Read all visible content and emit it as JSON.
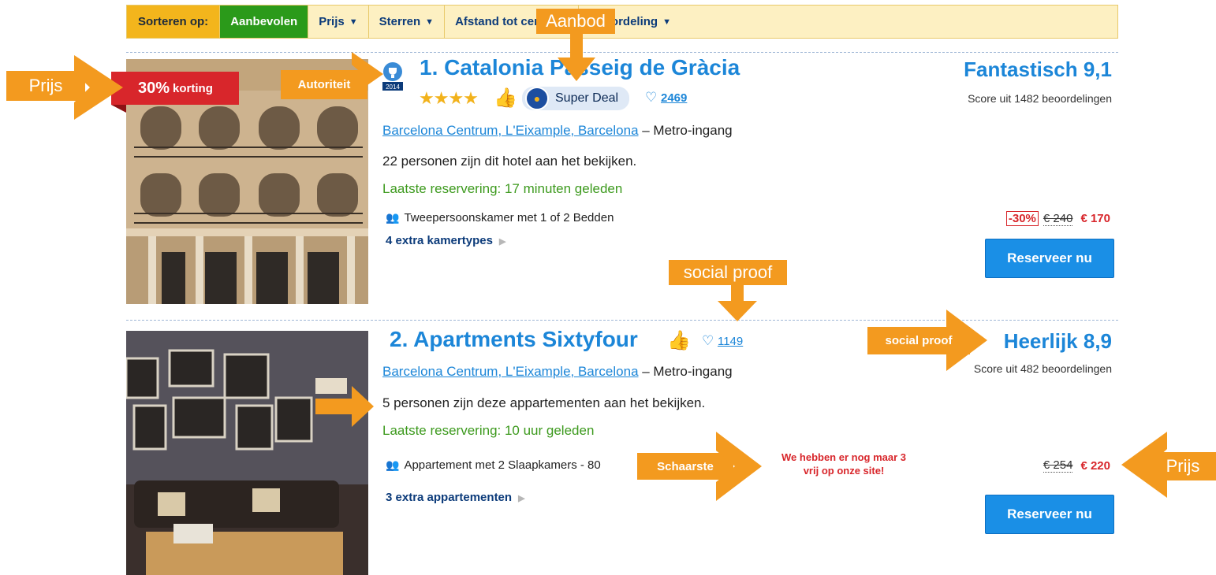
{
  "sortbar": {
    "label": "Sorteren op:",
    "items": [
      {
        "label": "Aanbevolen",
        "caret": ""
      },
      {
        "label": "Prijs",
        "caret": "▼"
      },
      {
        "label": "Sterren",
        "caret": "▼"
      },
      {
        "label": "Afstand tot centrum",
        "caret": ""
      },
      {
        "label": "Beoordeling",
        "caret": "▼"
      }
    ]
  },
  "hotels": [
    {
      "title": "1. Catalonia Passeig de Gràcia",
      "rating_word": "Fantastisch 9,1",
      "score_sub": "Score uit 1482 beoordelingen",
      "deal_percent": "30%",
      "deal_word": "korting",
      "award_year": "2014",
      "stars": "★★★★",
      "super_deal": "Super Deal",
      "favorites": "2469",
      "location_link": "Barcelona Centrum, L'Eixample, Barcelona",
      "location_suffix": " – Metro-ingang",
      "viewers": "22 personen zijn dit hotel aan het bekijken.",
      "last_booking": "Laatste reservering: 17 minuten geleden",
      "room": "Tweepersoonskamer met 1 of 2 Bedden",
      "extra": "4 extra kamertypes",
      "discount_badge": "-30%",
      "old_price": "€ 240",
      "new_price": "€ 170",
      "book_label": "Reserveer nu"
    },
    {
      "title": "2. Apartments Sixtyfour",
      "rating_word": "Heerlijk 8,9",
      "score_sub": "Score uit 482 beoordelingen",
      "favorites": "1149",
      "location_link": "Barcelona Centrum, L'Eixample, Barcelona",
      "location_suffix": " – Metro-ingang",
      "viewers": "5 personen zijn deze appartementen aan het bekijken.",
      "last_booking": "Laatste reservering: 10 uur geleden",
      "room": "Appartement met 2 Slaapkamers - 80",
      "extra": "3 extra appartementen",
      "scarcity_line1": "We hebben er nog maar 3",
      "scarcity_line2": "vrij op onze site!",
      "old_price": "€ 254",
      "new_price": "€ 220",
      "book_label": "Reserveer nu"
    }
  ],
  "annotations": {
    "prijs_left": "Prijs",
    "autoriteit": "Autoriteit",
    "aanbod": "Aanbod",
    "social_proof_1": "social proof",
    "social_proof_2": "social proof",
    "schaarste": "Schaarste",
    "prijs_right": "Prijs"
  },
  "colors": {
    "accent": "#1c86d8",
    "annotation": "#f39a1f",
    "deal_red": "#d8262b",
    "active_sort": "#2b9a1a"
  }
}
